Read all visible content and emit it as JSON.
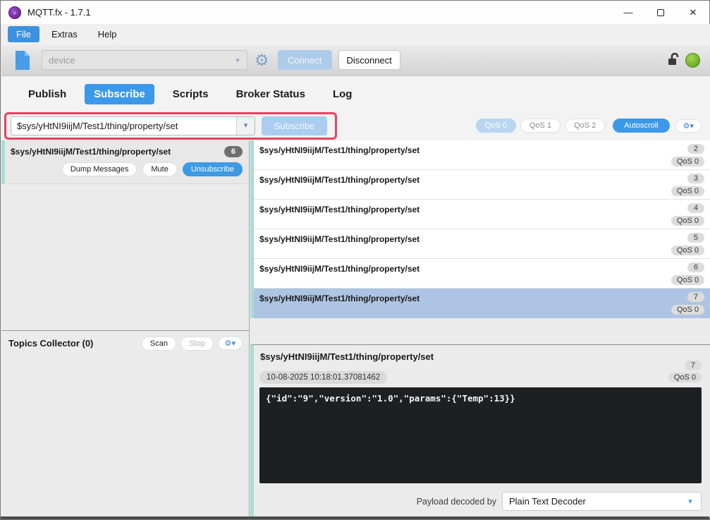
{
  "window": {
    "title": "MQTT.fx - 1.7.1"
  },
  "icons": {
    "gear": "⚙",
    "caret_down": "▾",
    "minimize": "—",
    "close": "✕",
    "gears_small": "⚙"
  },
  "menu": {
    "items": [
      {
        "label": "File"
      },
      {
        "label": "Extras"
      },
      {
        "label": "Help"
      }
    ]
  },
  "toolbar": {
    "profile_placeholder": "device",
    "connect_label": "Connect",
    "disconnect_label": "Disconnect"
  },
  "tabs": [
    {
      "label": "Publish"
    },
    {
      "label": "Subscribe"
    },
    {
      "label": "Scripts"
    },
    {
      "label": "Broker Status"
    },
    {
      "label": "Log"
    }
  ],
  "subscribe_bar": {
    "topic_value": "$sys/yHtNI9iijM/Test1/thing/property/set",
    "subscribe_label": "Subscribe",
    "qos0_label": "QoS 0",
    "qos1_label": "QoS 1",
    "qos2_label": "QoS 2",
    "autoscroll_label": "Autoscroll"
  },
  "subscription_card": {
    "topic": "$sys/yHtNI9iijM/Test1/thing/property/set",
    "count": "6",
    "dump_label": "Dump Messages",
    "mute_label": "Mute",
    "unsubscribe_label": "Unsubscribe"
  },
  "topics_collector": {
    "title": "Topics Collector (0)",
    "scan_label": "Scan",
    "stop_label": "Stop"
  },
  "messages": [
    {
      "topic": "$sys/yHtNI9iijM/Test1/thing/property/set",
      "id": "2",
      "qos": "QoS 0",
      "selected": false
    },
    {
      "topic": "$sys/yHtNI9iijM/Test1/thing/property/set",
      "id": "3",
      "qos": "QoS 0",
      "selected": false
    },
    {
      "topic": "$sys/yHtNI9iijM/Test1/thing/property/set",
      "id": "4",
      "qos": "QoS 0",
      "selected": false
    },
    {
      "topic": "$sys/yHtNI9iijM/Test1/thing/property/set",
      "id": "5",
      "qos": "QoS 0",
      "selected": false
    },
    {
      "topic": "$sys/yHtNI9iijM/Test1/thing/property/set",
      "id": "6",
      "qos": "QoS 0",
      "selected": false
    },
    {
      "topic": "$sys/yHtNI9iijM/Test1/thing/property/set",
      "id": "7",
      "qos": "QoS 0",
      "selected": true
    }
  ],
  "detail": {
    "topic": "$sys/yHtNI9iijM/Test1/thing/property/set",
    "id": "7",
    "qos": "QoS 0",
    "timestamp": "10-08-2025  10:18:01.37081462",
    "payload": "{\"id\":\"9\",\"version\":\"1.0\",\"params\":{\"Temp\":13}}",
    "decoder_label": "Payload decoded by",
    "decoder_value": "Plain Text Decoder"
  },
  "colors": {
    "accent_blue": "#3c99e9",
    "disabled_blue": "#aecbe9",
    "annotation_red": "#e9425e",
    "teal_strip": "#abdcd6",
    "selected_row": "#aec4e3",
    "status_green": "#76b82a",
    "payload_bg": "#1e1f21"
  }
}
